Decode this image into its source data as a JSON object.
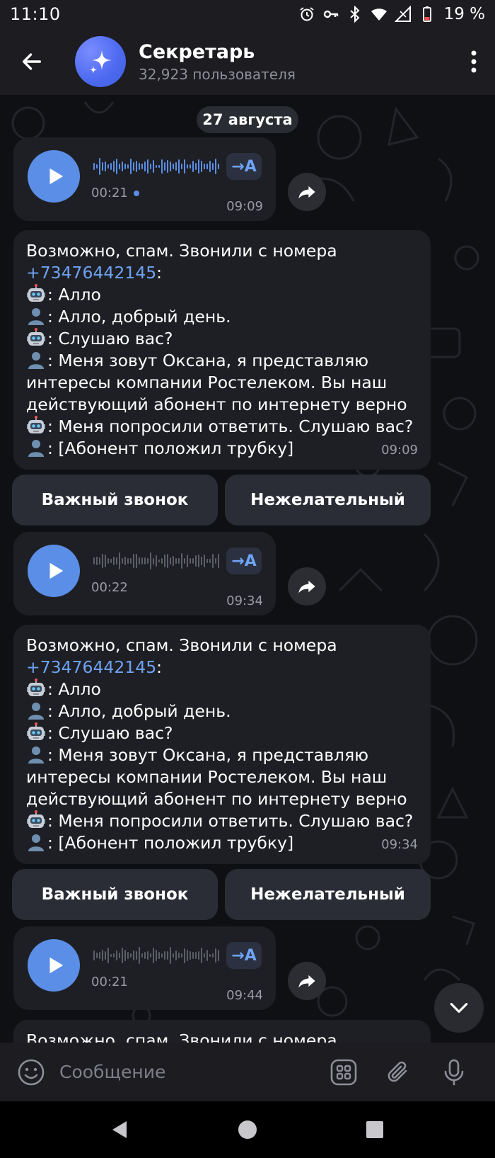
{
  "status_bar": {
    "time": "11:10",
    "battery": "19 %"
  },
  "header": {
    "title": "Секретарь",
    "subtitle": "32,923 пользователя"
  },
  "date_separator": "27 августа",
  "messages": [
    {
      "voice": {
        "duration": "00:21",
        "time": "09:09",
        "translate_label": "→A",
        "unread": true
      },
      "text": {
        "intro": "Возможно, спам. Звонили с номера",
        "phone": "+73476442145",
        "lines": [
          ": Алло",
          ": Алло, добрый день.",
          ": Слушаю вас?",
          ": Меня зовут Оксана, я представляю",
          "интересы компании Ростелеком. Вы наш",
          "действующий абонент по интернету верно",
          ": Меня попросили ответить. Слушаю вас?",
          ": [Абонент положил трубку]"
        ],
        "time": "09:09"
      },
      "buttons": [
        "Важный звонок",
        "Нежелательный"
      ]
    },
    {
      "voice": {
        "duration": "00:22",
        "time": "09:34",
        "translate_label": "→A",
        "unread": false
      },
      "text": {
        "intro": "Возможно, спам. Звонили с номера",
        "phone": "+73476442145",
        "lines": [
          ": Алло",
          ": Алло, добрый день.",
          ": Слушаю вас?",
          ": Меня зовут Оксана, я представляю",
          "интересы компании Ростелеком. Вы наш",
          "действующий абонент по интернету верно",
          ": Меня попросили ответить. Слушаю вас?",
          ": [Абонент положил трубку]"
        ],
        "time": "09:34"
      },
      "buttons": [
        "Важный звонок",
        "Нежелательный"
      ]
    },
    {
      "voice": {
        "duration": "00:21",
        "time": "09:44",
        "translate_label": "→A",
        "unread": false
      },
      "text": {
        "intro": "Возможно, спам. Звонили с номера"
      }
    }
  ],
  "input": {
    "placeholder": "Сообщение"
  },
  "icons": {
    "back": "arrow-left-icon",
    "avatar": "sparkle-icon",
    "menu": "more-vertical-icon",
    "play": "play-icon",
    "share": "share-icon",
    "scroll_down": "chevron-down-icon",
    "emoji": "smile-icon",
    "attach": "grid-icon",
    "paperclip": "paperclip-icon",
    "mic": "mic-icon",
    "robot": "robot-emoji",
    "person": "person-emoji"
  },
  "colors": {
    "accent": "#5b8ee6",
    "link": "#6ea3f5",
    "bubble": "#1e1f24",
    "header": "#1c1c21"
  }
}
